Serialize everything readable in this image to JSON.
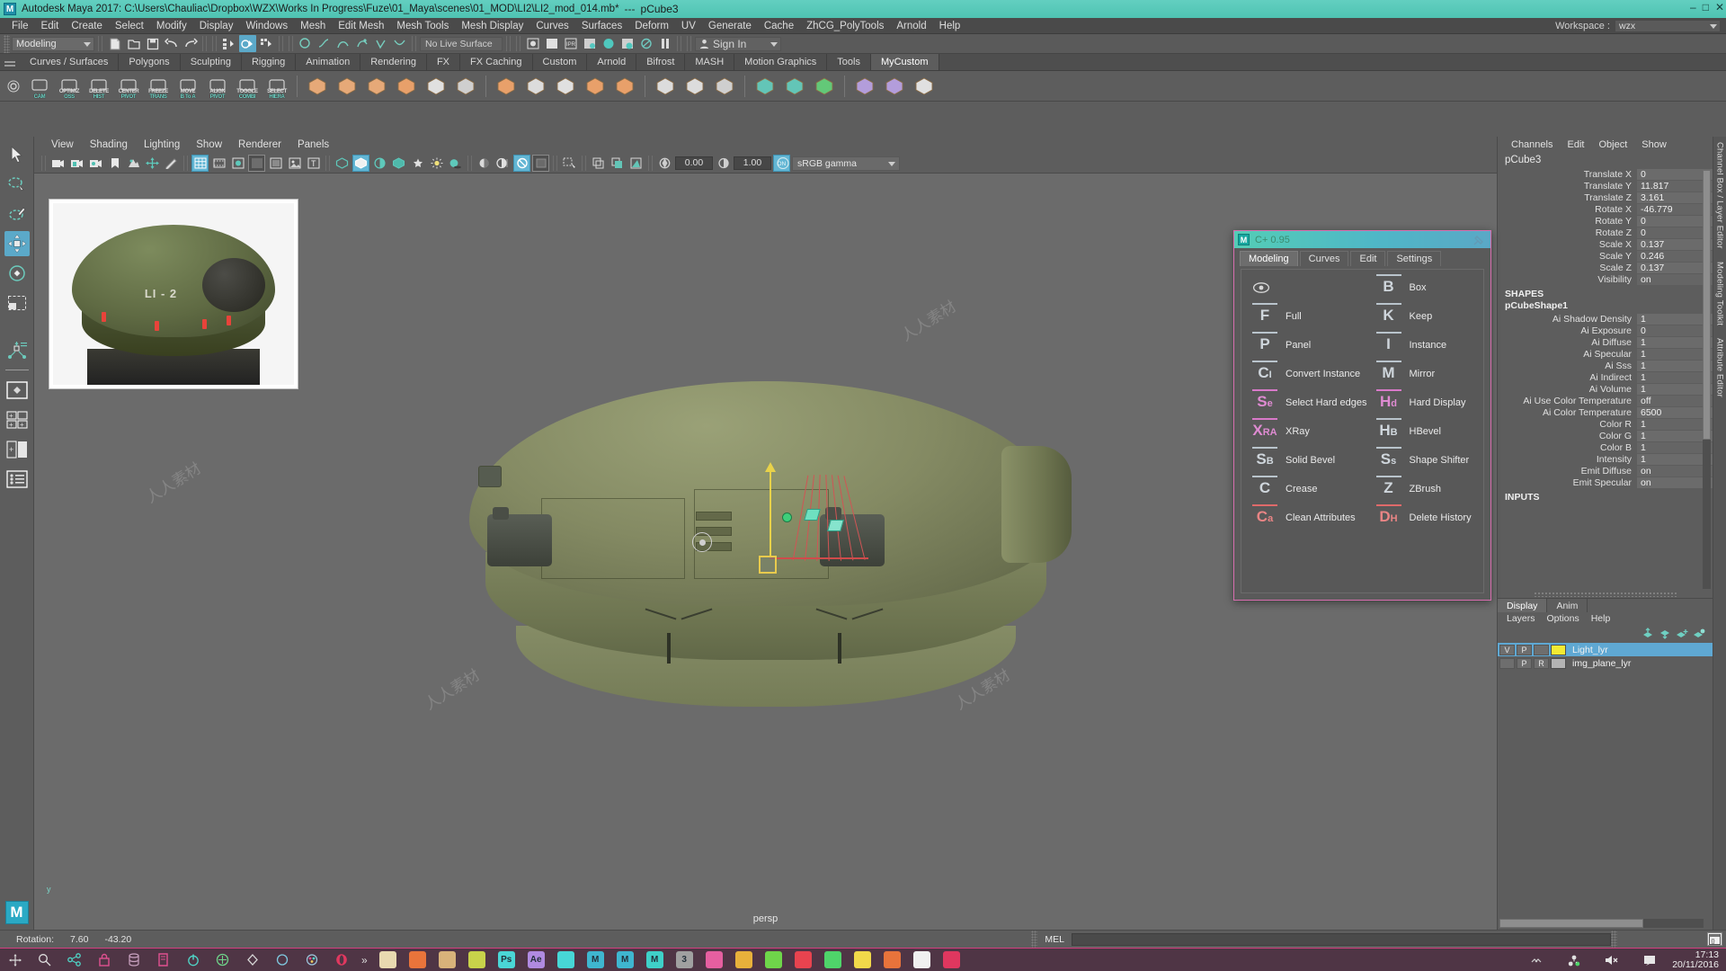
{
  "titlebar": {
    "app_title": "Autodesk Maya 2017: C:\\Users\\Chauliac\\Dropbox\\WZX\\Works In Progress\\Fuze\\01_Maya\\scenes\\01_MOD\\LI2\\LI2_mod_014.mb*",
    "separator": "---",
    "selected_object": "pCube3",
    "logo": "M",
    "minimize": "–",
    "maximize": "□",
    "close": "✕"
  },
  "menubar": {
    "items": [
      "File",
      "Edit",
      "Create",
      "Select",
      "Modify",
      "Display",
      "Windows",
      "Mesh",
      "Edit Mesh",
      "Mesh Tools",
      "Mesh Display",
      "Curves",
      "Surfaces",
      "Deform",
      "UV",
      "Generate",
      "Cache",
      "ZhCG_PolyTools",
      "Arnold",
      "Help"
    ],
    "workspace_label": "Workspace :",
    "workspace_value": "wzx"
  },
  "statusline": {
    "menuset": "Modeling",
    "no_live_surface": "No Live Surface",
    "signin": "Sign In"
  },
  "shelf": {
    "tabs": [
      "Curves / Surfaces",
      "Polygons",
      "Sculpting",
      "Rigging",
      "Animation",
      "Rendering",
      "FX",
      "FX Caching",
      "Custom",
      "Arnold",
      "Bifrost",
      "MASH",
      "Motion Graphics",
      "Tools",
      "MyCustom"
    ],
    "active_tab": "MyCustom",
    "buttons": [
      {
        "top": "",
        "mid": "",
        "bot": "CAM"
      },
      {
        "top": "OPTIMIZ",
        "mid": "",
        "bot": "OSS"
      },
      {
        "top": "DELETE",
        "mid": "",
        "bot": "HIST"
      },
      {
        "top": "CENTER",
        "mid": "",
        "bot": "PIVOT"
      },
      {
        "top": "FREEZE",
        "mid": "0,0,0",
        "bot": "TRANS"
      },
      {
        "top": "MOVE",
        "mid": "",
        "bot": "B To A"
      },
      {
        "top": "ALIGN",
        "mid": "",
        "bot": "PIVOT"
      },
      {
        "top": "TOGGLE",
        "mid": "",
        "bot": "COMBI"
      },
      {
        "top": "SELECT",
        "mid": "",
        "bot": "HIERA"
      }
    ]
  },
  "viewport": {
    "menu": [
      "View",
      "Shading",
      "Lighting",
      "Show",
      "Renderer",
      "Panels"
    ],
    "exposure": "0.00",
    "gamma": "1.00",
    "color_mgmt_toggle": "ON",
    "color_profile": "sRGB gamma",
    "camera_label": "persp",
    "axis_label": "y",
    "reference_image_text": "LI - 2",
    "watermark": "人人素材"
  },
  "channelbox": {
    "menu": [
      "Channels",
      "Edit",
      "Object",
      "Show"
    ],
    "object_name": "pCube3",
    "transform_rows": [
      {
        "key": "Translate X",
        "value": "0"
      },
      {
        "key": "Translate Y",
        "value": "11.817"
      },
      {
        "key": "Translate Z",
        "value": "3.161"
      },
      {
        "key": "Rotate X",
        "value": "-46.779"
      },
      {
        "key": "Rotate Y",
        "value": "0"
      },
      {
        "key": "Rotate Z",
        "value": "0"
      },
      {
        "key": "Scale X",
        "value": "0.137"
      },
      {
        "key": "Scale Y",
        "value": "0.246"
      },
      {
        "key": "Scale Z",
        "value": "0.137"
      },
      {
        "key": "Visibility",
        "value": "on"
      }
    ],
    "shapes_header": "SHAPES",
    "shape_name": "pCubeShape1",
    "shape_rows": [
      {
        "key": "Ai Shadow Density",
        "value": "1"
      },
      {
        "key": "Ai Exposure",
        "value": "0"
      },
      {
        "key": "Ai Diffuse",
        "value": "1"
      },
      {
        "key": "Ai Specular",
        "value": "1"
      },
      {
        "key": "Ai Sss",
        "value": "1"
      },
      {
        "key": "Ai Indirect",
        "value": "1"
      },
      {
        "key": "Ai Volume",
        "value": "1"
      },
      {
        "key": "Ai Use Color Temperature",
        "value": "off"
      },
      {
        "key": "Ai Color Temperature",
        "value": "6500"
      },
      {
        "key": "Color R",
        "value": "1"
      },
      {
        "key": "Color G",
        "value": "1"
      },
      {
        "key": "Color B",
        "value": "1"
      },
      {
        "key": "Intensity",
        "value": "1"
      },
      {
        "key": "Emit Diffuse",
        "value": "on"
      },
      {
        "key": "Emit Specular",
        "value": "on"
      }
    ],
    "inputs_header": "INPUTS"
  },
  "layereditor": {
    "tabs": [
      "Display",
      "Anim"
    ],
    "active_tab": "Display",
    "menu": [
      "Layers",
      "Options",
      "Help"
    ],
    "layers": [
      {
        "visible": "V",
        "playback": "P",
        "extra": "",
        "color": "#f2ea32",
        "name": "Light_lyr",
        "selected": true
      },
      {
        "visible": "",
        "playback": "P",
        "extra": "R",
        "color": "#b4b4b4",
        "name": "img_plane_lyr",
        "selected": false
      }
    ]
  },
  "sidetabs": [
    "Channel Box / Layer Editor",
    "Modeling Toolkit",
    "Attribute Editor"
  ],
  "floating_panel": {
    "title": "C+ 0.95",
    "logo": "M",
    "tabs": [
      "Modeling",
      "Curves",
      "Edit",
      "Settings"
    ],
    "active_tab": "Modeling",
    "items": [
      {
        "key": "",
        "sub": "",
        "label": "",
        "icon": "eye-icon",
        "color": "default",
        "col": 0,
        "row": 0
      },
      {
        "key": "B",
        "sub": "",
        "label": "Box",
        "color": "default",
        "col": 1,
        "row": 0
      },
      {
        "key": "F",
        "sub": "",
        "label": "Full",
        "color": "default",
        "col": 0,
        "row": 1
      },
      {
        "key": "K",
        "sub": "",
        "label": "Keep",
        "color": "default",
        "col": 1,
        "row": 1
      },
      {
        "key": "P",
        "sub": "",
        "label": "Panel",
        "color": "default",
        "col": 0,
        "row": 2
      },
      {
        "key": "I",
        "sub": "",
        "label": "Instance",
        "color": "default",
        "col": 1,
        "row": 2
      },
      {
        "key": "C",
        "sub": "I",
        "label": "Convert Instance",
        "color": "default",
        "col": 0,
        "row": 3
      },
      {
        "key": "M",
        "sub": "",
        "label": "Mirror",
        "color": "default",
        "col": 1,
        "row": 3
      },
      {
        "key": "S",
        "sub": "e",
        "label": "Select Hard edges",
        "color": "pink",
        "col": 0,
        "row": 4
      },
      {
        "key": "H",
        "sub": "d",
        "label": "Hard Display",
        "color": "pink",
        "col": 1,
        "row": 4
      },
      {
        "key": "X",
        "sub": "RA",
        "label": "XRay",
        "color": "pink",
        "col": 0,
        "row": 5
      },
      {
        "key": "H",
        "sub": "B",
        "label": "HBevel",
        "color": "default",
        "col": 1,
        "row": 5
      },
      {
        "key": "S",
        "sub": "B",
        "label": "Solid Bevel",
        "color": "default",
        "col": 0,
        "row": 6
      },
      {
        "key": "S",
        "sub": "s",
        "label": "Shape Shifter",
        "color": "default",
        "col": 1,
        "row": 6
      },
      {
        "key": "C",
        "sub": "",
        "label": "Crease",
        "color": "default",
        "col": 0,
        "row": 7
      },
      {
        "key": "Z",
        "sub": "",
        "label": "ZBrush",
        "color": "default",
        "col": 1,
        "row": 7
      },
      {
        "key": "C",
        "sub": "a",
        "label": "Clean Attributes",
        "color": "red",
        "col": 0,
        "row": 8
      },
      {
        "key": "D",
        "sub": "H",
        "label": "Delete History",
        "color": "red",
        "col": 1,
        "row": 8
      }
    ]
  },
  "bottombar": {
    "rotation_label": "Rotation:",
    "rotation_x": "7.60",
    "rotation_y": "-43.20",
    "script_lang": "MEL",
    "command_value": ""
  },
  "taskbar": {
    "overflow": "»",
    "clock_time": "17:13",
    "clock_date": "20/11/2016",
    "apps": [
      {
        "name": "save-icon",
        "glyph": "Ὃe",
        "color": "#e8d9b0",
        "label": ""
      },
      {
        "name": "chrome-icon",
        "glyph": "",
        "color": "#e8743b",
        "label": ""
      },
      {
        "name": "folder-icon",
        "glyph": "",
        "color": "#d8b27a",
        "label": ""
      },
      {
        "name": "cinema4d-icon",
        "glyph": "",
        "color": "#c8d24a",
        "label": ""
      },
      {
        "name": "photoshop-icon",
        "glyph": "Ps",
        "color": "#4ad6d6",
        "label": "Ps"
      },
      {
        "name": "aftereffects-icon",
        "glyph": "Ae",
        "color": "#b08ae0",
        "label": "Ae"
      },
      {
        "name": "opera-icon",
        "glyph": "",
        "color": "#47d6d6",
        "label": ""
      },
      {
        "name": "maya-icon-1",
        "glyph": "M",
        "color": "#3fb6d0",
        "label": "M"
      },
      {
        "name": "maya-icon-2",
        "glyph": "M",
        "color": "#3fb6d0",
        "label": "M"
      },
      {
        "name": "maya-icon-3",
        "glyph": "M",
        "color": "#3fd0c8",
        "label": "M"
      },
      {
        "name": "3dsmax-icon",
        "glyph": "3",
        "color": "#a0a0a0",
        "label": "3"
      },
      {
        "name": "zbrush-icon",
        "glyph": "",
        "color": "#e55fa0",
        "label": ""
      },
      {
        "name": "substance-icon",
        "glyph": "",
        "color": "#e8b03b",
        "label": ""
      },
      {
        "name": "evernote-icon",
        "glyph": "",
        "color": "#6fd44a",
        "label": ""
      },
      {
        "name": "pocket-icon",
        "glyph": "",
        "color": "#e8434f",
        "label": ""
      },
      {
        "name": "spotify-icon",
        "glyph": "",
        "color": "#4fd46a",
        "label": ""
      },
      {
        "name": "explorer-icon",
        "glyph": "",
        "color": "#f2d84a",
        "label": ""
      },
      {
        "name": "quixel-icon",
        "glyph": "",
        "color": "#e8733b",
        "label": ""
      },
      {
        "name": "marmoset-icon",
        "glyph": "",
        "color": "#f0f0f0",
        "label": ""
      },
      {
        "name": "opera-icon-2",
        "glyph": "",
        "color": "#e0375f",
        "label": ""
      }
    ]
  },
  "colors": {
    "title_teal": "#4fc3b2",
    "ui_gray": "#5d5d5d",
    "accent_blue": "#5ba9c9",
    "panel_border_pink": "#d86fb0",
    "taskbar": "#4f3545",
    "taskbar_accent": "#d1407f",
    "layer_yellow": "#f2ea32",
    "selected_layer_blue": "#5fa8d3"
  }
}
